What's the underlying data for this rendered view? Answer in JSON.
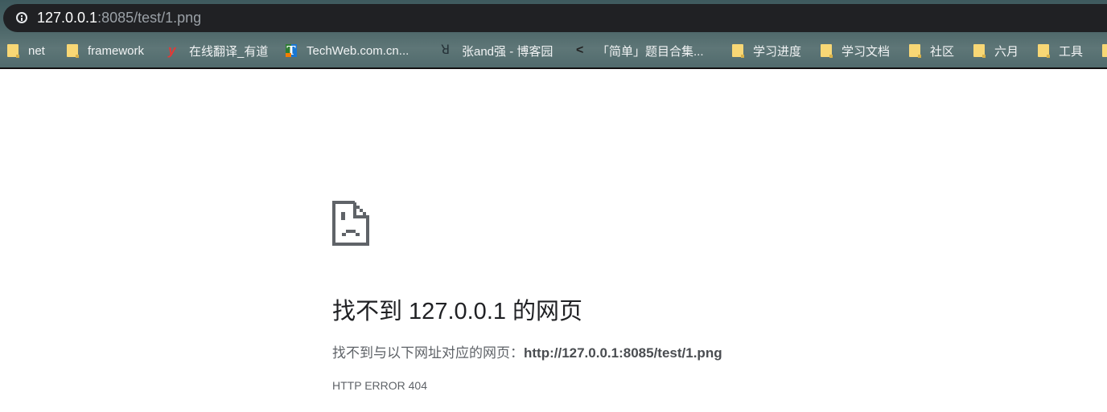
{
  "address_bar": {
    "host": "127.0.0.1",
    "rest": ":8085/test/1.png",
    "icon": "info-icon"
  },
  "bookmarks": [
    {
      "label": "net",
      "icon": "folder-icon"
    },
    {
      "label": "framework",
      "icon": "folder-icon"
    },
    {
      "label": "在线翻译_有道",
      "icon": "youdao-icon"
    },
    {
      "label": "TechWeb.com.cn...",
      "icon": "techweb-icon"
    },
    {
      "label": "张and强 - 博客园",
      "icon": "cnblogs-icon"
    },
    {
      "label": "「简单」题目合集...",
      "icon": "leetcode-icon"
    },
    {
      "label": "学习进度",
      "icon": "folder-icon"
    },
    {
      "label": "学习文档",
      "icon": "folder-icon"
    },
    {
      "label": "社区",
      "icon": "folder-icon"
    },
    {
      "label": "六月",
      "icon": "folder-icon"
    },
    {
      "label": "工具",
      "icon": "folder-icon"
    }
  ],
  "error_page": {
    "icon": "sad-page-icon",
    "title": "找不到 127.0.0.1 的网页",
    "description_prefix": "找不到与以下网址对应的网页：",
    "description_url": "http://127.0.0.1:8085/test/1.png",
    "error_code": "HTTP ERROR 404"
  }
}
